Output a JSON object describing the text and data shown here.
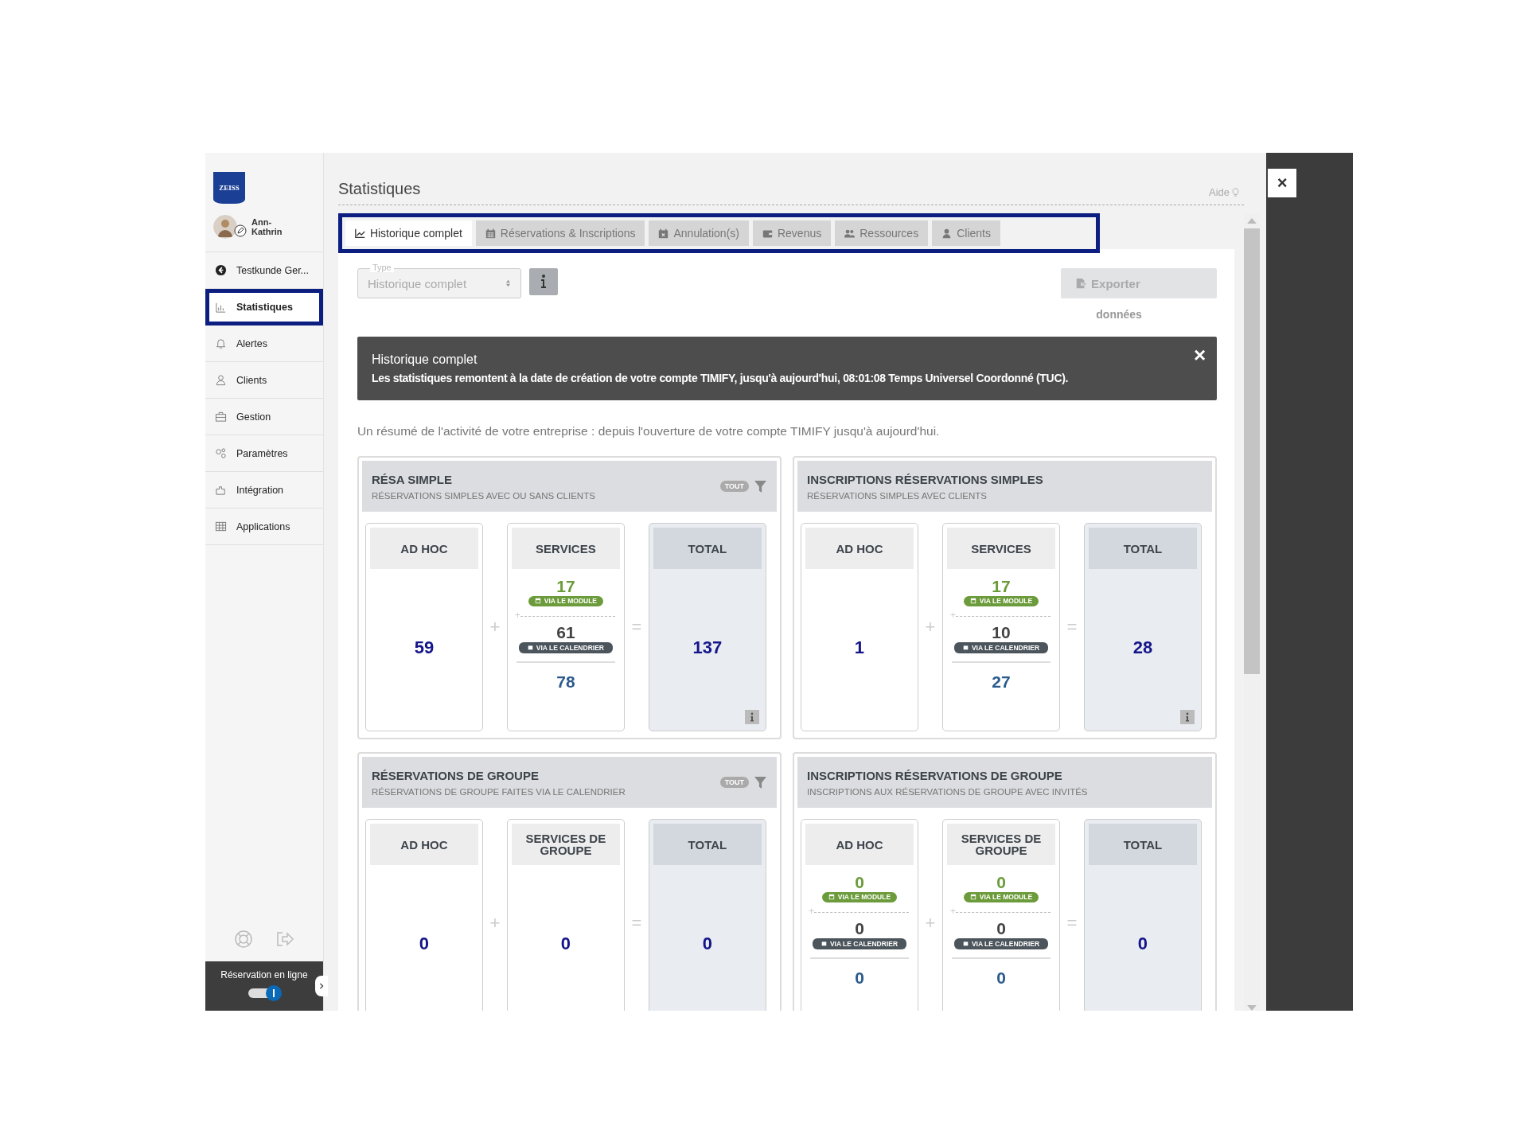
{
  "sidebar": {
    "logo": "ZEISS",
    "user": "Ann-Kathrin",
    "items": [
      {
        "label": "Testkunde Ger...",
        "selected": false
      },
      {
        "label": "Statistiques",
        "selected": true
      },
      {
        "label": "Alertes",
        "selected": false
      },
      {
        "label": "Clients",
        "selected": false
      },
      {
        "label": "Gestion",
        "selected": false
      },
      {
        "label": "Paramètres",
        "selected": false
      },
      {
        "label": "Intégration",
        "selected": false
      },
      {
        "label": "Applications",
        "selected": false
      }
    ],
    "online_booking": {
      "label": "Réservation en ligne",
      "on": true
    }
  },
  "header": {
    "title": "Statistiques",
    "help": "Aide"
  },
  "close_button": "×",
  "tabs": [
    {
      "label": "Historique complet",
      "selected": true
    },
    {
      "label": "Réservations & Inscriptions",
      "selected": false
    },
    {
      "label": "Annulation(s)",
      "selected": false
    },
    {
      "label": "Revenus",
      "selected": false
    },
    {
      "label": "Ressources",
      "selected": false
    },
    {
      "label": "Clients",
      "selected": false
    }
  ],
  "type_select": {
    "label": "Type",
    "value": "Historique complet",
    "disabled": true
  },
  "export_button": {
    "label": "Exporter",
    "caption": "données",
    "disabled": true
  },
  "alert": {
    "title": "Historique complet",
    "message": "Les statistiques remontent à la date de création de votre compte TIMIFY, jusqu'à aujourd'hui, 08:01:08 Temps Universel Coordonné (TUC).",
    "close": "×"
  },
  "summary": "Un résumé de l'activité de votre entreprise : depuis l'ouverture de votre compte TIMIFY jusqu'à aujourd'hui.",
  "panels": [
    {
      "title": "RÉSA SIMPLE",
      "subtitle": "RÉSERVATIONS SIMPLES AVEC OU SANS CLIENTS",
      "filter": "TOUT",
      "plus": "+",
      "equals": "=",
      "columns": [
        {
          "kind": "plain",
          "heading": "AD HOC",
          "value": "59"
        },
        {
          "kind": "split",
          "heading": "SERVICES",
          "module": "17",
          "module_badge": "VIA LE MODULE",
          "calendar": "61",
          "calendar_badge": "VIA LE CALENDRIER",
          "sum": "78"
        },
        {
          "kind": "total",
          "heading": "TOTAL",
          "value": "137",
          "info": true
        }
      ]
    },
    {
      "title": "INSCRIPTIONS RÉSERVATIONS SIMPLES",
      "subtitle": "RÉSERVATIONS SIMPLES AVEC CLIENTS",
      "plus": "+",
      "equals": "=",
      "columns": [
        {
          "kind": "plain",
          "heading": "AD HOC",
          "value": "1"
        },
        {
          "kind": "split",
          "heading": "SERVICES",
          "module": "17",
          "module_badge": "VIA LE MODULE",
          "calendar": "10",
          "calendar_badge": "VIA LE CALENDRIER",
          "sum": "27"
        },
        {
          "kind": "total",
          "heading": "TOTAL",
          "value": "28",
          "info": true
        }
      ]
    },
    {
      "title": "RÉSERVATIONS DE GROUPE",
      "subtitle": "RÉSERVATIONS DE GROUPE FAITES VIA LE CALENDRIER",
      "filter": "TOUT",
      "plus": "+",
      "equals": "=",
      "columns": [
        {
          "kind": "plain",
          "heading": "AD HOC",
          "value": "0"
        },
        {
          "kind": "plain",
          "heading": "SERVICES DE GROUPE",
          "value": "0"
        },
        {
          "kind": "total",
          "heading": "TOTAL",
          "value": "0",
          "info": false
        }
      ]
    },
    {
      "title": "INSCRIPTIONS RÉSERVATIONS DE GROUPE",
      "subtitle": "INSCRIPTIONS AUX RÉSERVATIONS DE GROUPE AVEC INVITÉS",
      "plus": "+",
      "equals": "=",
      "columns": [
        {
          "kind": "split",
          "heading": "AD HOC",
          "module": "0",
          "module_badge": "VIA LE MODULE",
          "calendar": "0",
          "calendar_badge": "VIA LE CALENDRIER",
          "sum": "0"
        },
        {
          "kind": "split",
          "heading": "SERVICES DE GROUPE",
          "module": "0",
          "module_badge": "VIA LE MODULE",
          "calendar": "0",
          "calendar_badge": "VIA LE CALENDRIER",
          "sum": "0"
        },
        {
          "kind": "total",
          "heading": "TOTAL",
          "value": "0",
          "info": false
        }
      ]
    }
  ]
}
